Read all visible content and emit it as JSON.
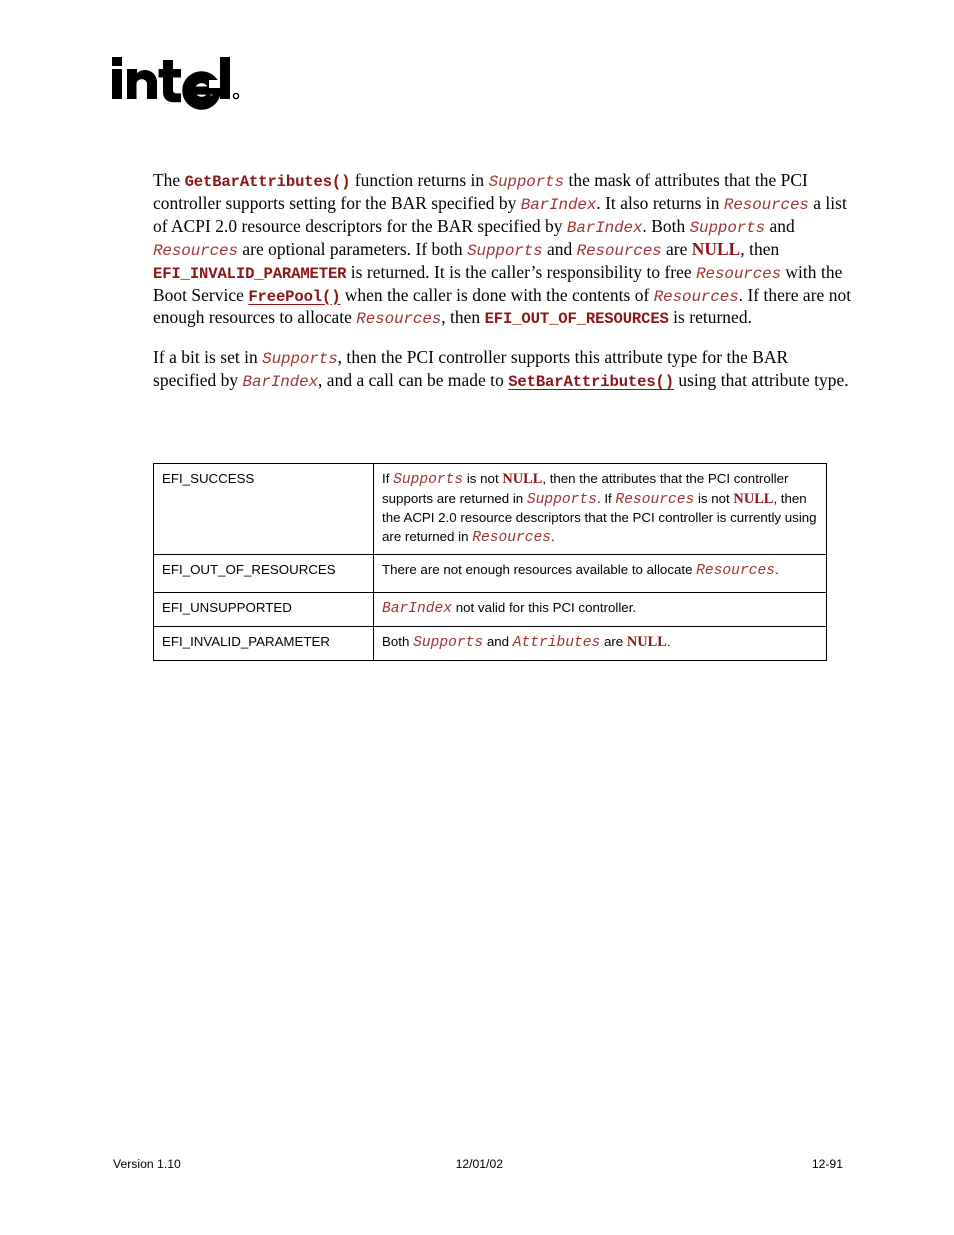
{
  "logo": {
    "wordmark": "intel",
    "registered_mark": "®"
  },
  "paragraphs": {
    "p1": {
      "segments": [
        {
          "text": "The ",
          "style": "plain"
        },
        {
          "text": "GetBarAttributes()",
          "style": "code-bold"
        },
        {
          "text": " function returns in ",
          "style": "plain"
        },
        {
          "text": "Supports",
          "style": "code-italic"
        },
        {
          "text": " the mask of attributes that the PCI controller supports setting for the BAR specified by ",
          "style": "plain"
        },
        {
          "text": "BarIndex",
          "style": "code-italic"
        },
        {
          "text": ".  It also returns in ",
          "style": "plain"
        },
        {
          "text": "Resources",
          "style": "code-italic"
        },
        {
          "text": " a list of ACPI 2.0 resource descriptors for the BAR specified by ",
          "style": "plain"
        },
        {
          "text": "BarIndex",
          "style": "code-italic"
        },
        {
          "text": ".  Both ",
          "style": "plain"
        },
        {
          "text": "Supports",
          "style": "code-italic"
        },
        {
          "text": " and ",
          "style": "plain"
        },
        {
          "text": "Resources",
          "style": "code-italic"
        },
        {
          "text": " are optional parameters.  If both ",
          "style": "plain"
        },
        {
          "text": "Supports",
          "style": "code-italic"
        },
        {
          "text": " and ",
          "style": "plain"
        },
        {
          "text": "Resources",
          "style": "code-italic"
        },
        {
          "text": " are ",
          "style": "plain"
        },
        {
          "text": "NULL",
          "style": "serif-bold-red"
        },
        {
          "text": ", then ",
          "style": "plain"
        },
        {
          "text": "EFI_INVALID_PARAMETER",
          "style": "code-bold"
        },
        {
          "text": " is returned.  It is the caller’s responsibility to free ",
          "style": "plain"
        },
        {
          "text": "Resources",
          "style": "code-italic"
        },
        {
          "text": " with the Boot Service ",
          "style": "plain"
        },
        {
          "text": "FreePool()",
          "style": "code-link"
        },
        {
          "text": " when the caller is done with the contents of ",
          "style": "plain"
        },
        {
          "text": "Resources",
          "style": "code-italic"
        },
        {
          "text": ".  If there are not enough resources to allocate ",
          "style": "plain"
        },
        {
          "text": "Resources",
          "style": "code-italic"
        },
        {
          "text": ", then ",
          "style": "plain"
        },
        {
          "text": "EFI_OUT_OF_RESOURCES",
          "style": "code-bold"
        },
        {
          "text": " is returned.",
          "style": "plain"
        }
      ]
    },
    "p2": {
      "segments": [
        {
          "text": "If a bit is set in ",
          "style": "plain"
        },
        {
          "text": "Supports",
          "style": "code-italic"
        },
        {
          "text": ", then the PCI controller supports this attribute type for the BAR specified by ",
          "style": "plain"
        },
        {
          "text": "BarIndex",
          "style": "code-italic"
        },
        {
          "text": ", and a call can be made to ",
          "style": "plain"
        },
        {
          "text": "SetBarAttributes()",
          "style": "code-link"
        },
        {
          "text": " using that attribute type.",
          "style": "plain"
        }
      ]
    }
  },
  "status_table": {
    "rows": [
      {
        "code": "EFI_SUCCESS",
        "description_segments": [
          {
            "text": "If ",
            "style": "plain"
          },
          {
            "text": "Supports",
            "style": "code-italic"
          },
          {
            "text": " is not ",
            "style": "plain"
          },
          {
            "text": "NULL",
            "style": "serif-bold-red"
          },
          {
            "text": ", then the attributes that the PCI controller supports are returned in ",
            "style": "plain"
          },
          {
            "text": "Supports",
            "style": "code-italic"
          },
          {
            "text": ".  If ",
            "style": "plain"
          },
          {
            "text": "Resources",
            "style": "code-italic"
          },
          {
            "text": " is not ",
            "style": "plain"
          },
          {
            "text": "NULL",
            "style": "serif-bold-red"
          },
          {
            "text": ", then the ACPI 2.0 resource descriptors that the PCI controller is currently using are returned in ",
            "style": "plain"
          },
          {
            "text": "Resources",
            "style": "code-italic"
          },
          {
            "text": ".",
            "style": "plain"
          }
        ]
      },
      {
        "code": "EFI_OUT_OF_RESOURCES",
        "description_segments": [
          {
            "text": "There are not enough resources available to allocate ",
            "style": "plain"
          },
          {
            "text": "Resources",
            "style": "code-italic"
          },
          {
            "text": ".",
            "style": "plain"
          }
        ]
      },
      {
        "code": "EFI_UNSUPPORTED",
        "description_segments": [
          {
            "text": "BarIndex",
            "style": "code-italic"
          },
          {
            "text": " not valid for this PCI controller.",
            "style": "plain"
          }
        ]
      },
      {
        "code": "EFI_INVALID_PARAMETER",
        "description_segments": [
          {
            "text": "Both ",
            "style": "plain"
          },
          {
            "text": "Supports",
            "style": "code-italic"
          },
          {
            "text": " and ",
            "style": "plain"
          },
          {
            "text": "Attributes",
            "style": "code-italic"
          },
          {
            "text": " are ",
            "style": "plain"
          },
          {
            "text": "NULL",
            "style": "serif-bold-red"
          },
          {
            "text": ".",
            "style": "plain"
          }
        ]
      }
    ]
  },
  "footer": {
    "version": "Version 1.10",
    "date": "12/01/02",
    "page_number": "12-91"
  },
  "colors": {
    "code_bold_red": "#8c1515",
    "code_italic_red": "#a03535",
    "body_text": "#000000",
    "rule": "#000000",
    "page_background": "#ffffff"
  }
}
